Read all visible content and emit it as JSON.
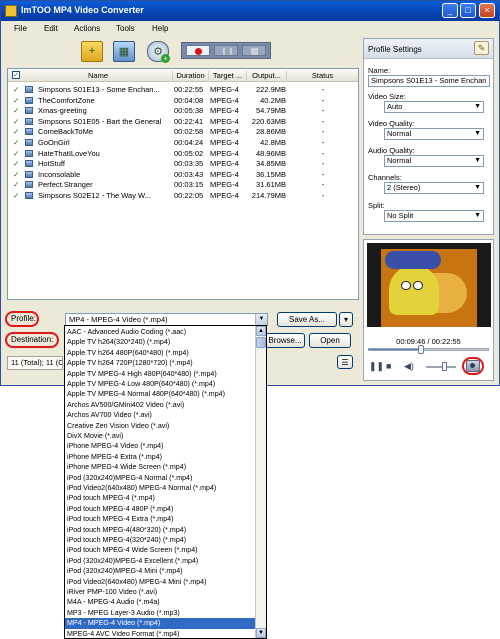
{
  "window": {
    "title": "ImTOO MP4 Video Converter"
  },
  "menubar": {
    "items": [
      "File",
      "Edit",
      "Actions",
      "Tools",
      "Help"
    ]
  },
  "table": {
    "headers": {
      "name": "Name",
      "duration": "Duration",
      "target": "Target ...",
      "output": "Output...",
      "status": "Status"
    },
    "rows": [
      {
        "name": "Simpsons S01E13 - Some Enchan...",
        "duration": "00:22:55",
        "target": "MPEG-4",
        "output": "222.9MB",
        "status": "-"
      },
      {
        "name": "TheComfortZone",
        "duration": "00:04:08",
        "target": "MPEG-4",
        "output": "40.2MB",
        "status": "-"
      },
      {
        "name": "Xmas-greeting",
        "duration": "00:05:38",
        "target": "MPEG-4",
        "output": "54.79MB",
        "status": "-"
      },
      {
        "name": "Simpsons S01E05 - Bart the General",
        "duration": "00:22:41",
        "target": "MPEG-4",
        "output": "220.63MB",
        "status": "-"
      },
      {
        "name": "ComeBackToMe",
        "duration": "00:02:58",
        "target": "MPEG-4",
        "output": "28.86MB",
        "status": "-"
      },
      {
        "name": "GoOnGirl",
        "duration": "00:04:24",
        "target": "MPEG-4",
        "output": "42.8MB",
        "status": "-"
      },
      {
        "name": "HateThatILoveYou",
        "duration": "00:05:02",
        "target": "MPEG-4",
        "output": "48.96MB",
        "status": "-"
      },
      {
        "name": "HotStuff",
        "duration": "00:03:35",
        "target": "MPEG-4",
        "output": "34.85MB",
        "status": "-"
      },
      {
        "name": "Inconsolable",
        "duration": "00:03:43",
        "target": "MPEG-4",
        "output": "36.15MB",
        "status": "-"
      },
      {
        "name": "Perfect.Stranger",
        "duration": "00:03:15",
        "target": "MPEG-4",
        "output": "31.61MB",
        "status": "-"
      },
      {
        "name": "Simpsons S02E12 - The Way W...",
        "duration": "00:22:05",
        "target": "MPEG-4",
        "output": "214.79MB",
        "status": "-"
      }
    ]
  },
  "profile_settings": {
    "header": "Profile Settings",
    "name_label": "Name:",
    "name_value": "Simpsons S01E13 - Some Enchan",
    "video_size_label": "Video Size:",
    "video_size_value": "Auto",
    "video_quality_label": "Video Quality:",
    "video_quality_value": "Normal",
    "audio_quality_label": "Audio Quality:",
    "audio_quality_value": "Normal",
    "channels_label": "Channels:",
    "channels_value": "2 (Stereo)",
    "split_label": "Split:",
    "split_value": "No Split"
  },
  "preview": {
    "time": "00:09:46 / 00:22:55",
    "progress": 0.43,
    "volume": 0.6
  },
  "bottom": {
    "profile_label": "Profile:",
    "profile_value": "MP4 - MPEG-4 Video (*.mp4)",
    "save_as": "Save As...",
    "destination_label": "Destination:",
    "browse": "Browse...",
    "open": "Open",
    "status": "11 (Total); 11 (C"
  },
  "dropdown": {
    "selected_index": 28,
    "items": [
      "AAC - Advanced Audio Coding (*.aac)",
      "Apple TV h264(320*240) (*.mp4)",
      "Apple TV h264 480P(640*480) (*.mp4)",
      "Apple TV h264 720P(1280*720) (*.mp4)",
      "Apple TV MPEG-4 High 480P(640*480) (*.mp4)",
      "Apple TV MPEG-4 Low 480P(640*480) (*.mp4)",
      "Apple TV MPEG-4 Normal 480P(640*480) (*.mp4)",
      "Archos AV500/GMini402 Video (*.avi)",
      "Archos AV700 Video (*.avi)",
      "Creative Zen Vision Video (*.avi)",
      "DivX Movie (*.avi)",
      "iPhone MPEG-4 Video (*.mp4)",
      "iPhone MPEG-4 Extra (*.mp4)",
      "iPhone MPEG-4 Wide Screen (*.mp4)",
      "iPod (320x240)MPEG-4 Normal (*.mp4)",
      "iPod Video2(640x480) MPEG-4 Normal (*.mp4)",
      "iPod touch MPEG-4 (*.mp4)",
      "iPod touch MPEG-4 480P (*.mp4)",
      "iPod touch MPEG-4 Extra (*.mp4)",
      "iPod touch MPEG-4(480*320) (*.mp4)",
      "iPod touch MPEG-4(320*240) (*.mp4)",
      "iPod touch MPEG-4 Wide Screen (*.mp4)",
      "iPod (320x240)MPEG-4 Excellent (*.mp4)",
      "iPod (320x240)MPEG-4 Mini (*.mp4)",
      "iPod Video2(640x480) MPEG-4 Mini (*.mp4)",
      "iRiver PMP-100 Video (*.avi)",
      "M4A - MPEG-4 Audio (*.m4a)",
      "MP3 - MPEG Layer-3 Audio (*.mp3)",
      "MP4 - MPEG-4 Video (*.mp4)",
      "MPEG-4 AVC Video Format (*.mp4)"
    ]
  }
}
